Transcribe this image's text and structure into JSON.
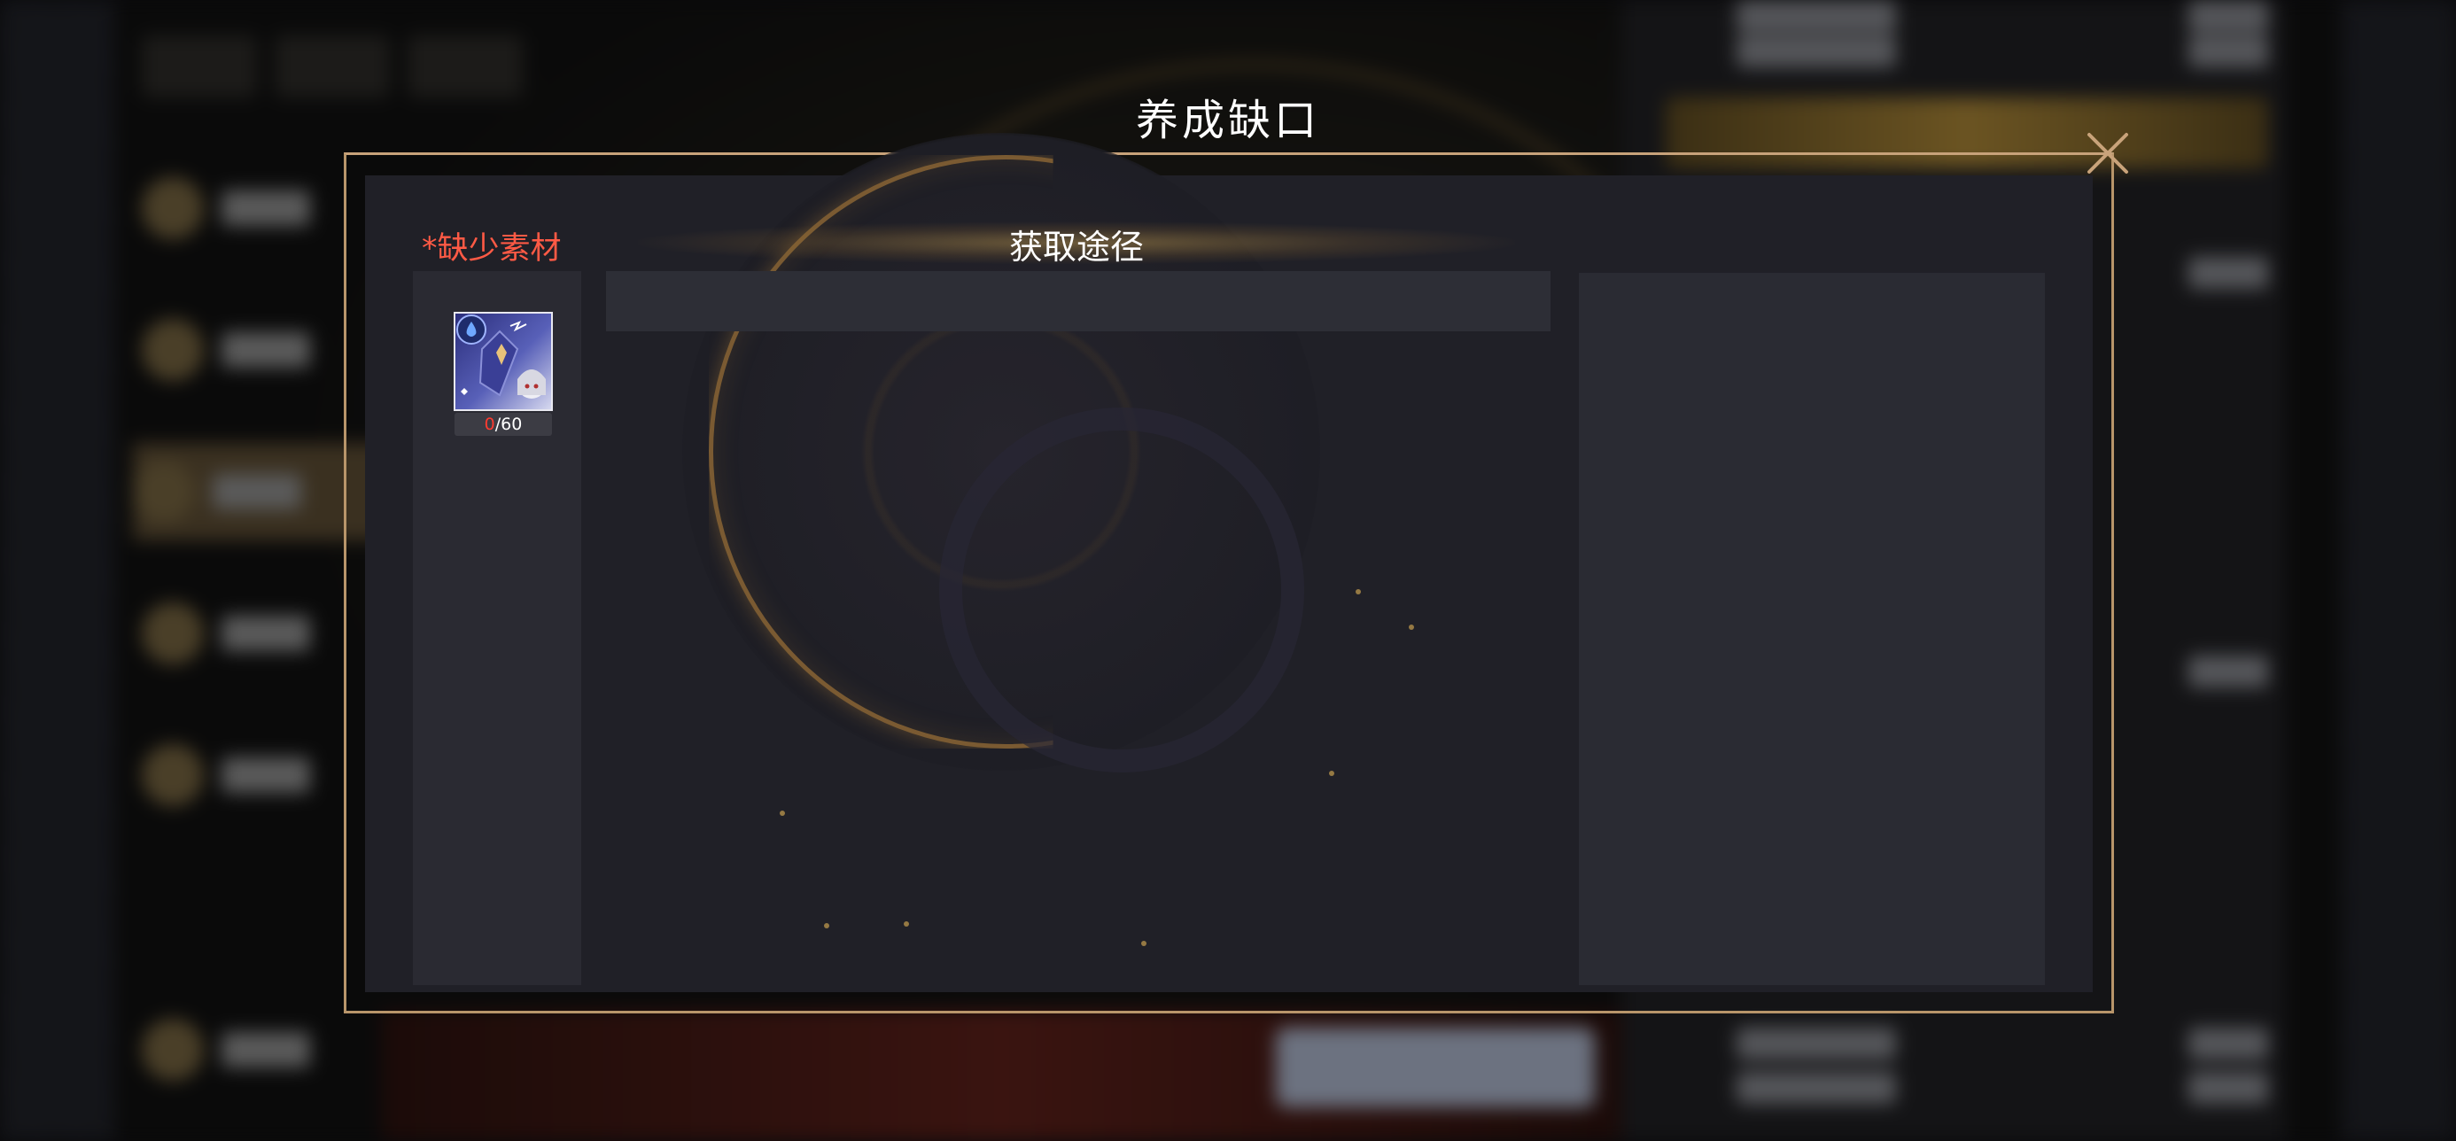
{
  "modal": {
    "title": "养成缺口",
    "close_icon": "close-icon"
  },
  "missing_materials": {
    "header": "*缺少素材",
    "items": [
      {
        "icon": "character-shard-icon",
        "owned": "0",
        "separator": "/",
        "required": "60"
      }
    ]
  },
  "acquisition": {
    "header": "获取途径",
    "rows": []
  },
  "colors": {
    "accent_gold": "#b8956a",
    "missing_red": "#ff5a45",
    "panel_bg": "#202027"
  }
}
